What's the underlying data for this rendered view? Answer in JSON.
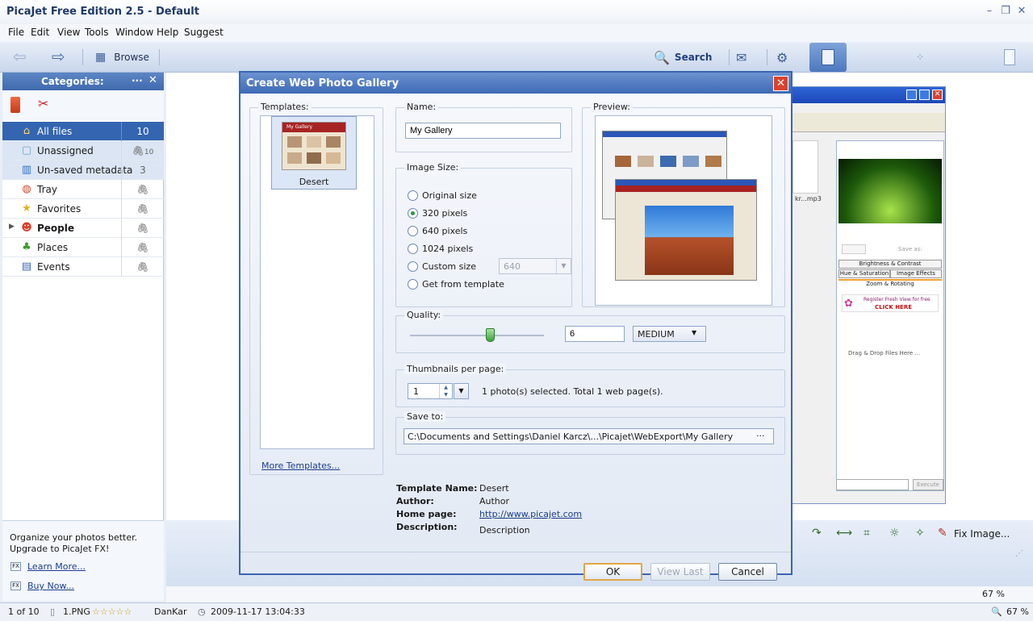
{
  "app": {
    "title": "PicaJet Free Edition 2.5  - Default"
  },
  "menu": [
    "File",
    "Edit",
    "View",
    "Tools",
    "Window",
    "Help",
    "Suggest"
  ],
  "toolbar": {
    "browse_label": "Browse",
    "search_label": "Search"
  },
  "categories": {
    "title": "Categories:",
    "items": [
      {
        "label": "All files",
        "count": "10",
        "icon": "home-icon"
      },
      {
        "label": "Unassigned",
        "count": "10",
        "icon": "box-icon"
      },
      {
        "label": "Un-saved metadata",
        "count": "3",
        "icon": "bars-icon"
      },
      {
        "label": "Tray",
        "count": "",
        "icon": "tray-icon"
      },
      {
        "label": "Favorites",
        "count": "",
        "icon": "star-icon"
      },
      {
        "label": "People",
        "count": "",
        "icon": "people-icon"
      },
      {
        "label": "Places",
        "count": "",
        "icon": "palm-icon"
      },
      {
        "label": "Events",
        "count": "",
        "icon": "calendar-icon"
      }
    ]
  },
  "promo": {
    "text1": "Organize your photos better.",
    "text2": "Upgrade to PicaJet FX!",
    "learn_more": "Learn More...",
    "buy_now": "Buy Now..."
  },
  "status": {
    "count": "1 of 10",
    "file": "1.PNG",
    "stars": "☆☆☆☆☆",
    "author": "DanKar",
    "datetime": "2009-11-17 13:04:33",
    "zoom": "67 %",
    "zoom_top": "67 %"
  },
  "bottom_toolbar": {
    "fix_image": "Fix Image..."
  },
  "bg_window": {
    "file_label": "kr...mp3",
    "brightness": "Brightness & Contrast",
    "hue": "Hue & Saturation",
    "effects": "Image Effects",
    "zoom_rotating": "Zoom & Rotating",
    "register1": "Register Fresh View for free",
    "register2": "CLICK HERE",
    "drag_drop": "Drag & Drop Files Here ...",
    "save_as": "Save as:",
    "execute": "Execute"
  },
  "dialog": {
    "title": "Create Web Photo Gallery",
    "templates_label": "Templates:",
    "template_name": "Desert",
    "template_thumb_caption": "My Gallery",
    "more_templates": "More Templates...",
    "name_label": "Name:",
    "name_value": "My Gallery",
    "preview_label": "Preview:",
    "image_size_label": "Image Size:",
    "size_options": [
      "Original size",
      "320 pixels",
      "640 pixels",
      "1024 pixels",
      "Custom size",
      "Get from template"
    ],
    "selected_size": "320 pixels",
    "custom_size_value": "640",
    "quality_label": "Quality:",
    "quality_value": "6",
    "quality_level": "MEDIUM",
    "quality_fraction": 0.6,
    "thumbs_label": "Thumbnails per page:",
    "thumbs_value": "1",
    "thumbs_info": "1 photo(s) selected. Total 1 web page(s).",
    "save_to_label": "Save to:",
    "save_to_value": "C:\\Documents and Settings\\Daniel Karcz\\...\\Picajet\\WebExport\\My Gallery",
    "browse_dots": "···",
    "info": {
      "template_name_label": "Template Name:",
      "template_name_value": "Desert",
      "author_label": "Author:",
      "author_value": "Author",
      "homepage_label": "Home page:",
      "homepage_value": "http://www.picajet.com",
      "description_label": "Description:",
      "description_value": "Description"
    },
    "ok": "OK",
    "view_last": "View Last",
    "cancel": "Cancel"
  },
  "colors": {
    "accent": "#3465b0",
    "title_blue": "#3d69b5",
    "close_red": "#d9422e"
  }
}
